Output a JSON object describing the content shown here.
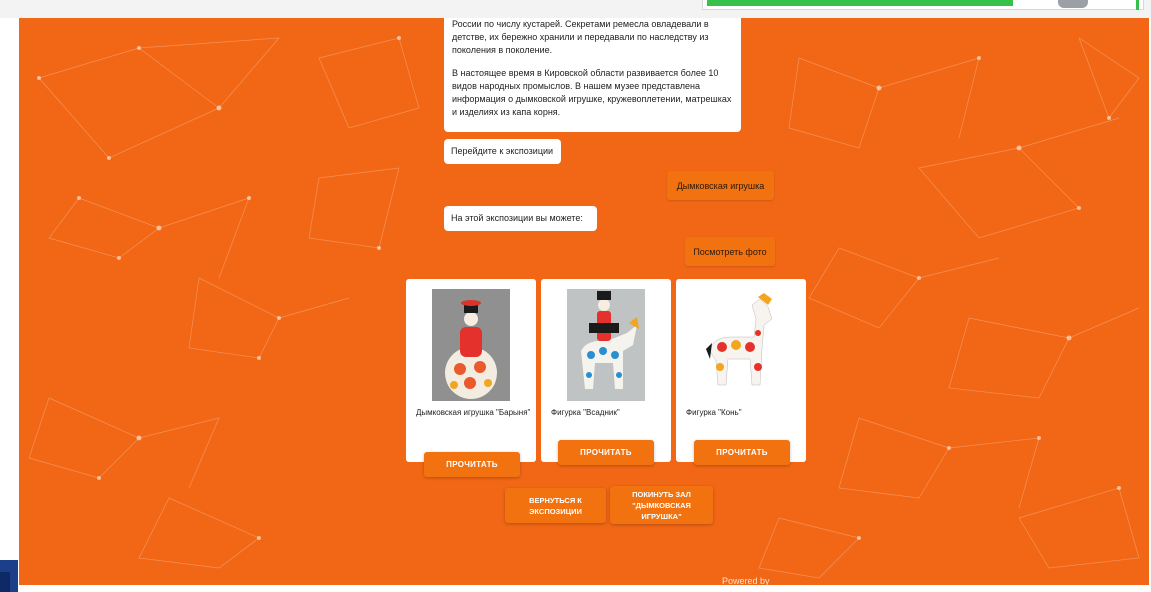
{
  "chat": {
    "intro_text_1": "России по числу кустарей. Секретами ремесла овладевали в детстве, их бережно хранили и передавали по наследству из поколения в поколение.",
    "intro_text_2": "В настоящее время в Кировской области развивается более 10 видов народных промыслов. В нашем музее представлена информация о дымковской игрушке, кружевоплетении, матрешках и изделиях из капа корня.",
    "prompt_exposition": "Перейдите к экспозиции",
    "user_choice": "Дымковская игрушка",
    "exposition_text": "На этой экспозиции вы можете:",
    "user_action": "Посмотреть фото"
  },
  "cards": [
    {
      "caption": "Дымковская игрушка \"Барыня\"",
      "button": "ПРОЧИТАТЬ",
      "icon": "lady-figurine-photo"
    },
    {
      "caption": "Фигурка \"Всадник\"",
      "button": "ПРОЧИТАТЬ",
      "icon": "rider-figurine-photo"
    },
    {
      "caption": "Фигурка \"Конь\"",
      "button": "ПРОЧИТАТЬ",
      "icon": "horse-figurine-photo"
    }
  ],
  "nav": {
    "back": "ВЕРНУТЬСЯ К ЭКСПОЗИЦИИ",
    "leave": "ПОКИНУТЬ ЗАЛ \"ДЫМКОВСКАЯ ИГРУШКА\""
  },
  "footer": {
    "powered": "Powered by"
  },
  "colors": {
    "background": "#f26716",
    "button": "#f2720f",
    "bubble": "#ffffff"
  }
}
